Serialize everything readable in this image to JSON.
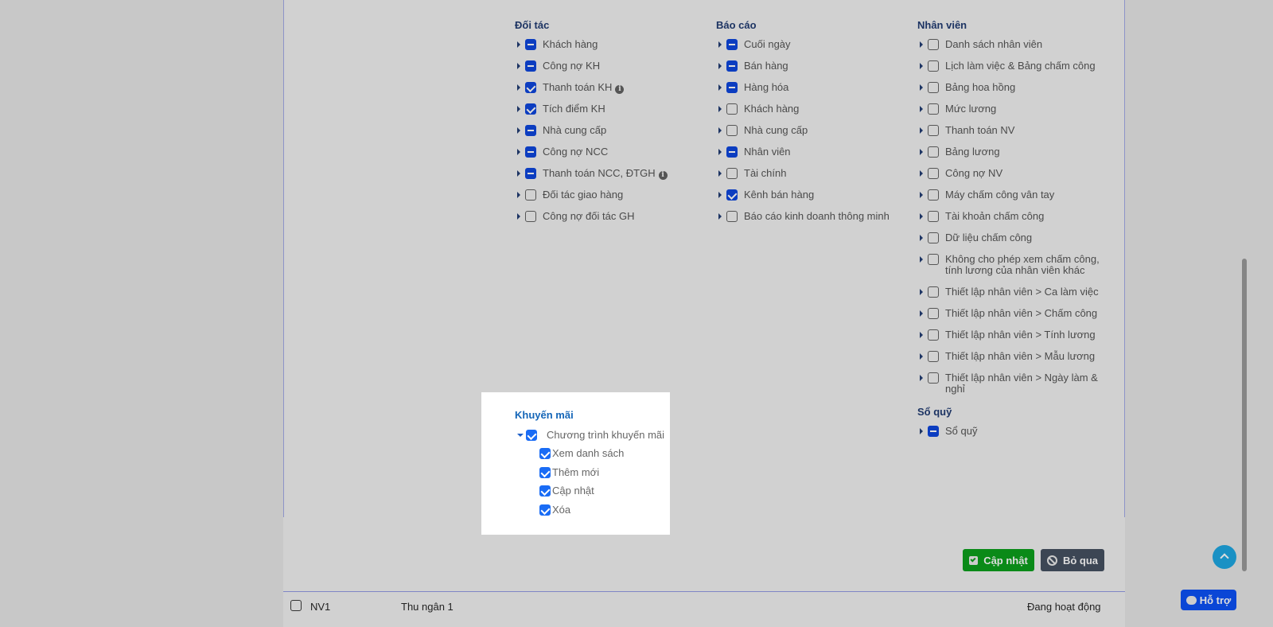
{
  "columns": [
    {
      "title": "Đối tác",
      "items": [
        {
          "label": "Khách hàng",
          "state": "partial"
        },
        {
          "label": "Công nợ KH",
          "state": "partial"
        },
        {
          "label": "Thanh toán KH",
          "state": "checked",
          "info": true
        },
        {
          "label": "Tích điểm KH",
          "state": "checked"
        },
        {
          "label": "Nhà cung cấp",
          "state": "partial"
        },
        {
          "label": "Công nợ NCC",
          "state": "partial"
        },
        {
          "label": "Thanh toán NCC, ĐTGH",
          "state": "partial",
          "info": true
        },
        {
          "label": "Đối tác giao hàng",
          "state": "unchecked"
        },
        {
          "label": "Công nợ đối tác GH",
          "state": "unchecked"
        }
      ]
    },
    {
      "title": "Báo cáo",
      "items": [
        {
          "label": "Cuối ngày",
          "state": "partial"
        },
        {
          "label": "Bán hàng",
          "state": "partial"
        },
        {
          "label": "Hàng hóa",
          "state": "partial"
        },
        {
          "label": "Khách hàng",
          "state": "unchecked"
        },
        {
          "label": "Nhà cung cấp",
          "state": "unchecked"
        },
        {
          "label": "Nhân viên",
          "state": "partial"
        },
        {
          "label": "Tài chính",
          "state": "unchecked"
        },
        {
          "label": "Kênh bán hàng",
          "state": "checked"
        },
        {
          "label": "Báo cáo kinh doanh thông minh",
          "state": "unchecked"
        }
      ]
    },
    {
      "title": "Nhân viên",
      "items": [
        {
          "label": "Danh sách nhân viên",
          "state": "unchecked"
        },
        {
          "label": "Lịch làm việc & Bảng chấm công",
          "state": "unchecked"
        },
        {
          "label": "Bảng hoa hồng",
          "state": "unchecked"
        },
        {
          "label": "Mức lương",
          "state": "unchecked"
        },
        {
          "label": "Thanh toán NV",
          "state": "unchecked"
        },
        {
          "label": "Bảng lương",
          "state": "unchecked"
        },
        {
          "label": "Công nợ NV",
          "state": "unchecked"
        },
        {
          "label": "Máy chấm công vân tay",
          "state": "unchecked"
        },
        {
          "label": "Tài khoản chấm công",
          "state": "unchecked"
        },
        {
          "label": "Dữ liệu chấm công",
          "state": "unchecked"
        },
        {
          "label": "Không cho phép xem chấm công, tính lương của nhân viên khác",
          "state": "unchecked"
        },
        {
          "label": "Thiết lập nhân viên > Ca làm việc",
          "state": "unchecked"
        },
        {
          "label": "Thiết lập nhân viên > Chấm công",
          "state": "unchecked"
        },
        {
          "label": "Thiết lập nhân viên > Tính lương",
          "state": "unchecked"
        },
        {
          "label": "Thiết lập nhân viên > Mẫu lương",
          "state": "unchecked"
        },
        {
          "label": "Thiết lập nhân viên > Ngày làm & nghỉ",
          "state": "unchecked"
        }
      ]
    }
  ],
  "so_quy": {
    "title": "Sổ quỹ",
    "items": [
      {
        "label": "Sổ quỹ",
        "state": "partial"
      }
    ]
  },
  "khuyen_mai": {
    "title": "Khuyến mãi",
    "parent": {
      "label": "Chương trình khuyến mãi",
      "state": "checked",
      "expanded": true
    },
    "children": [
      {
        "label": "Xem danh sách",
        "state": "checked"
      },
      {
        "label": "Thêm mới",
        "state": "checked"
      },
      {
        "label": "Cập nhật",
        "state": "checked"
      },
      {
        "label": "Xóa",
        "state": "checked"
      }
    ]
  },
  "buttons": {
    "save": "Cập nhật",
    "cancel": "Bỏ qua",
    "support": "Hỗ trợ"
  },
  "row": {
    "code": "NV1",
    "name": "Thu ngân 1",
    "status": "Đang hoạt động"
  },
  "colors": {
    "save": "#0a8a18",
    "cancel": "#3c4654",
    "support": "#0a46d6",
    "scroll_top": "#1a91c4"
  }
}
